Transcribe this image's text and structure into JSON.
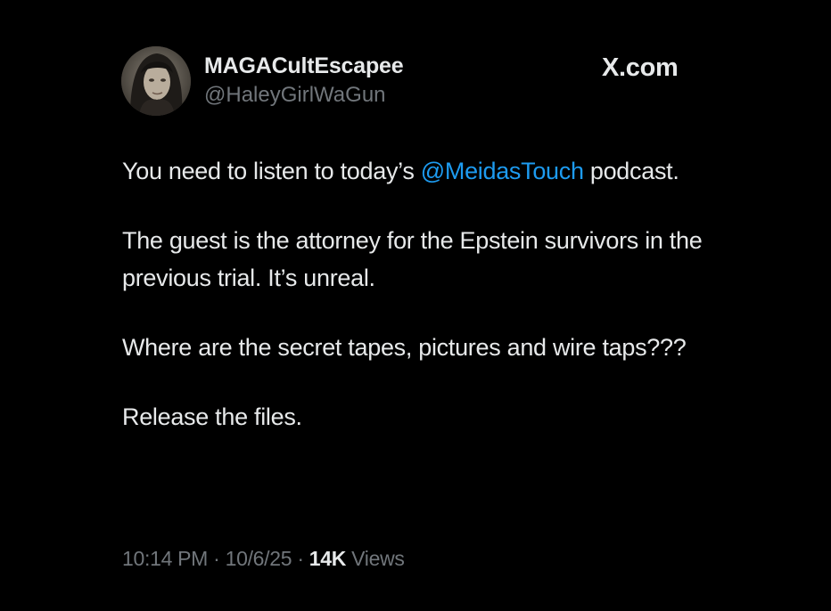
{
  "author": {
    "display_name": "MAGACultEscapee",
    "handle": "@HaleyGirlWaGun"
  },
  "brand": "X.com",
  "tweet": {
    "line1_prefix": "You need to listen to today’s ",
    "mention": "@MeidasTouch",
    "line1_suffix": " podcast.",
    "paragraph2": "The guest is the attorney for the Epstein survivors in the previous trial. It’s unreal.",
    "paragraph3": "Where are the secret tapes, pictures and wire taps???",
    "paragraph4": "Release the files."
  },
  "meta": {
    "time": "10:14 PM",
    "separator": " · ",
    "date": "10/6/25",
    "views_count": "14K",
    "views_label": " Views"
  },
  "colors": {
    "background": "#000000",
    "text": "#e7e9ea",
    "secondary": "#71767b",
    "mention": "#1d9bf0"
  },
  "icons": {
    "avatar": "profile-photo"
  }
}
